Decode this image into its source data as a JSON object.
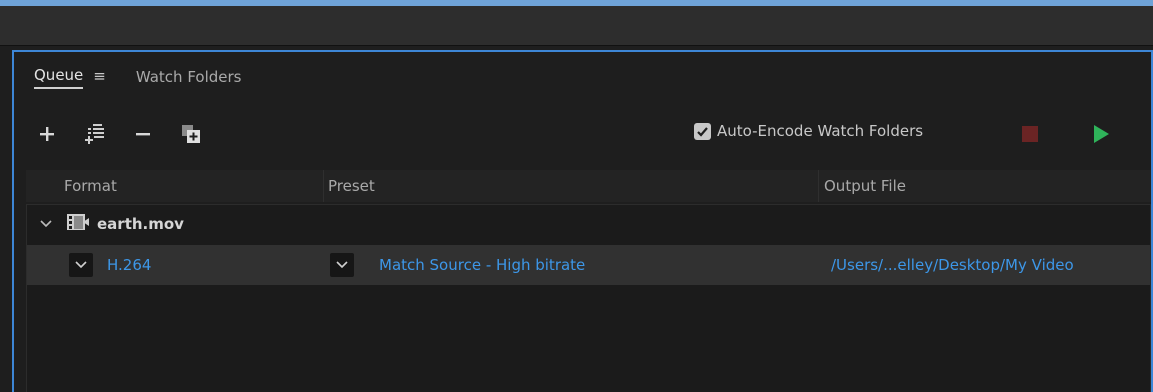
{
  "tabs": {
    "queue_label": "Queue",
    "watch_folders_label": "Watch Folders"
  },
  "toolbar": {
    "tools": [
      "add-source-icon",
      "add-output-icon",
      "remove-icon",
      "duplicate-icon"
    ],
    "auto_encode_label": "Auto-Encode Watch Folders",
    "auto_encode_checked": true
  },
  "columns": {
    "format": "Format",
    "preset": "Preset",
    "output_file": "Output File"
  },
  "queue": {
    "source": {
      "name": "earth.mov",
      "expanded": true,
      "output": {
        "format": "H.264",
        "preset": "Match Source - High bitrate",
        "output_file": "/Users/...elley/Desktop/My Video"
      }
    }
  },
  "colors": {
    "accent": "#3d86d6",
    "link": "#3d97e8",
    "stop": "#6b2424",
    "play": "#2fb35a"
  }
}
